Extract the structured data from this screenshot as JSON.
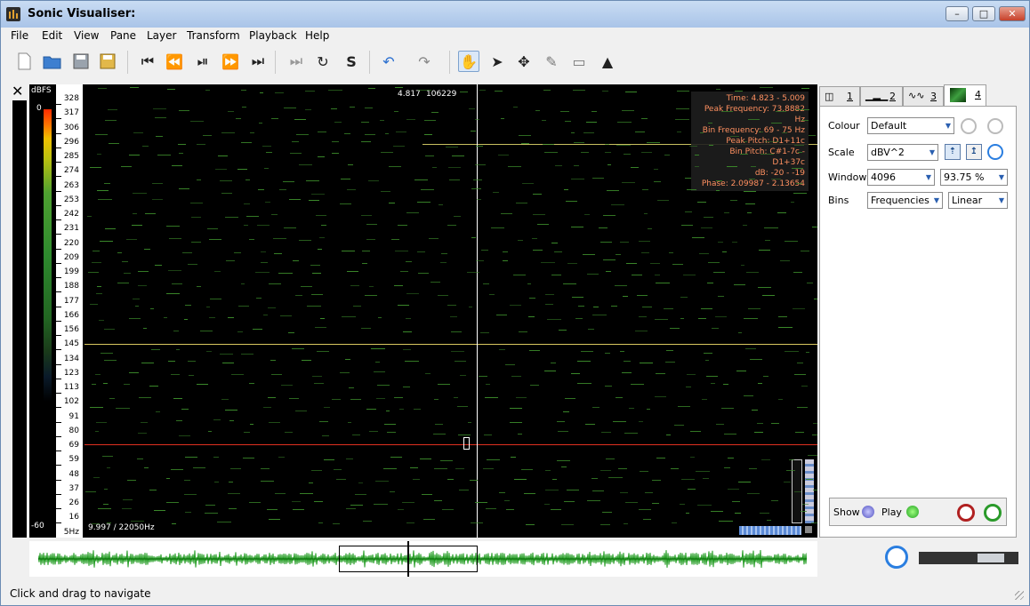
{
  "window": {
    "title": "Sonic Visualiser:",
    "controls": [
      "–",
      "□",
      "✕"
    ]
  },
  "menu": [
    "File",
    "Edit",
    "View",
    "Pane",
    "Layer",
    "Transform",
    "Playback",
    "Help"
  ],
  "toolbar": {
    "icons": [
      "new-file-icon",
      "open-file-icon",
      "save-icon",
      "save-session-icon",
      "rewind-start-icon",
      "rewind-icon",
      "play-pause-icon",
      "fast-forward-icon",
      "ffwd-end-icon",
      "constrain-icon",
      "loop-icon",
      "solo-icon",
      "undo-icon",
      "redo-icon",
      "navigate-hand-icon",
      "select-arrow-icon",
      "move-icon",
      "draw-pencil-icon",
      "erase-icon",
      "measure-icon"
    ]
  },
  "spectrogram": {
    "scale_title": "dBFS",
    "db_top": "0",
    "db_bottom": "-60",
    "freq_labels": [
      "328",
      "317",
      "306",
      "296",
      "285",
      "274",
      "263",
      "253",
      "242",
      "231",
      "220",
      "209",
      "199",
      "188",
      "177",
      "166",
      "156",
      "145",
      "134",
      "123",
      "113",
      "102",
      "91",
      "80",
      "69",
      "59",
      "48",
      "37",
      "26",
      "16",
      "5Hz"
    ],
    "cursor_time": "4.817",
    "cursor_frame": "106229",
    "info": [
      "Time: 4.823 - 5.009",
      "Peak Frequency: 73.8882 Hz",
      "Bin Frequency: 69 - 75 Hz",
      "Peak Pitch: D1+11c",
      "Bin Pitch: C#1-7c - D1+37c",
      "dB: -20 - -19",
      "Phase: 2.09987 - 2.13654"
    ],
    "bottom_left": "9.997 / 22050Hz",
    "colors": {
      "background": "#000000",
      "line_yellow": "#e0d060",
      "line_red": "#e03020",
      "partial": "#3b8a2a"
    }
  },
  "tabs": [
    {
      "num": "1"
    },
    {
      "num": "2"
    },
    {
      "num": "3"
    },
    {
      "num": "4"
    }
  ],
  "layer_panel": {
    "colour_label": "Colour",
    "colour_value": "Default",
    "scale_label": "Scale",
    "scale_value": "dBV^2",
    "window_label": "Window",
    "window_value": "4096",
    "overlap_value": "93.75 %",
    "bins_label": "Bins",
    "bins_value": "Frequencies",
    "bins_scale": "Linear",
    "show_label": "Show",
    "play_label": "Play"
  },
  "status": "Click and drag to navigate"
}
